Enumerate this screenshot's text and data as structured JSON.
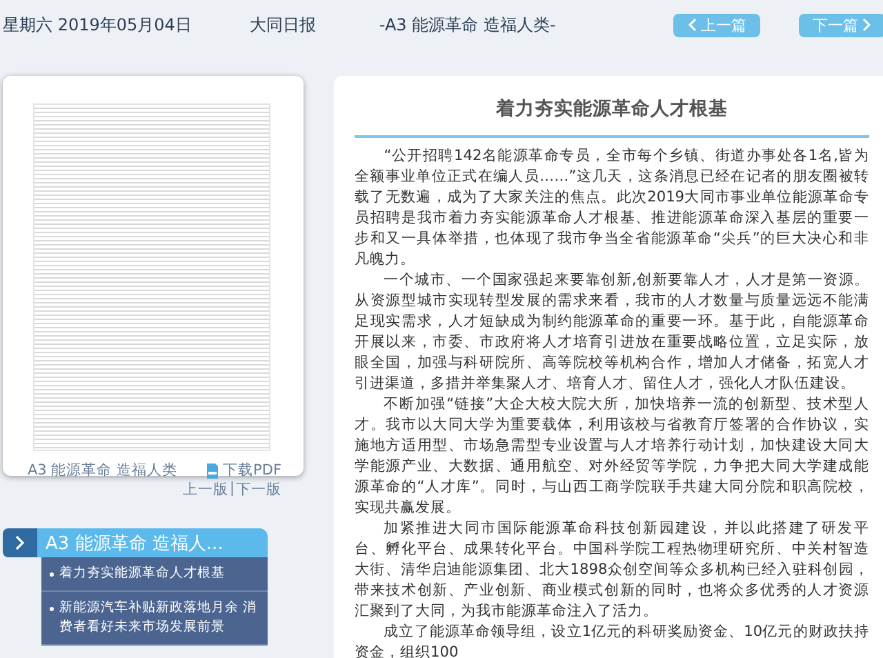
{
  "header": {
    "date": "星期六 2019年05月04日",
    "paper": "大同日报",
    "section": "-A3 能源革命 造福人类-",
    "buttons": [
      {
        "kind": "prev",
        "label": "上一篇"
      },
      {
        "kind": "next",
        "label": "下一篇"
      }
    ]
  },
  "page_card": {
    "caption": "A3 能源革命 造福人类",
    "download": "下载PDF",
    "page_links": [
      "上一版",
      "下一版"
    ],
    "separator": "|"
  },
  "section_nav": {
    "title": "A3  能源革命 造福人...",
    "items": [
      {
        "title": "着力夯实能源革命人才根基",
        "selected": false
      },
      {
        "title": "新能源汽车补贴新政落地月余 消费者看好未来市场发展前景",
        "selected": false
      }
    ]
  },
  "article": {
    "title": "着力夯实能源革命人才根基",
    "paragraphs": [
      "“公开招聘142名能源革命专员，全市每个乡镇、街道办事处各1名,皆为全额事业单位正式在编人员……”这几天，这条消息已经在记者的朋友圈被转载了无数遍，成为了大家关注的焦点。此次2019大同市事业单位能源革命专员招聘是我市着力夯实能源革命人才根基、推进能源革命深入基层的重要一步和又一具体举措，也体现了我市争当全省能源革命“尖兵”的巨大决心和非凡魄力。",
      "一个城市、一个国家强起来要靠创新,创新要靠人才，人才是第一资源。从资源型城市实现转型发展的需求来看，我市的人才数量与质量远远不能满足现实需求，人才短缺成为制约能源革命的重要一环。基于此，自能源革命开展以来，市委、市政府将人才培育引进放在重要战略位置，立足实际，放眼全国，加强与科研院所、高等院校等机构合作，增加人才储备，拓宽人才引进渠道，多措并举集聚人才、培育人才、留住人才，强化人才队伍建设。",
      "不断加强“链接”大企大校大院大所，加快培养一流的创新型、技术型人才。我市以大同大学为重要载体，利用该校与省教育厅签署的合作协议，实施地方适用型、市场急需型专业设置与人才培养行动计划，加快建设大同大学能源产业、大数据、通用航空、对外经贸等学院，力争把大同大学建成能源革命的“人才库”。同时，与山西工商学院联手共建大同分院和职高院校，实现共赢发展。",
      "加紧推进大同市国际能源革命科技创新园建设，并以此搭建了研发平台、孵化平台、成果转化平台。中国科学院工程热物理研究所、中关村智造大街、清华启迪能源集团、北大1898众创空间等众多机构已经入驻科创园，带来技术创新、产业创新、商业模式创新的同时，也将众多优秀的人才资源汇聚到了大同，为我市能源革命注入了活力。",
      "成立了能源革命领导组，设立1亿元的科研奖励资金、10亿元的财政扶持资金，组织100"
    ]
  }
}
